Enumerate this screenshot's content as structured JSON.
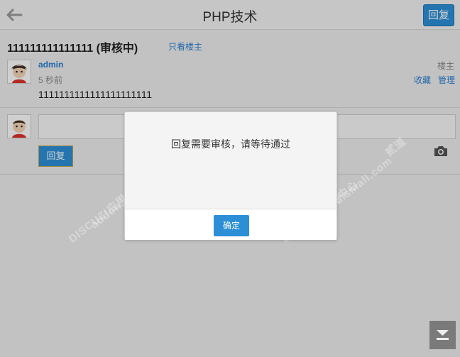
{
  "header": {
    "back_icon": "arrow-left-icon",
    "title": "PHP技术",
    "reply_label": "回复"
  },
  "thread": {
    "title": "111111111111111 (审核中)",
    "only_op_label": "只看楼主"
  },
  "post": {
    "author": "admin",
    "time": "5 秒前",
    "op_badge": "楼主",
    "favorite_label": "收藏",
    "manage_label": "管理",
    "content": "1111111111111111111111"
  },
  "reply_form": {
    "input_value": "",
    "submit_label": "回复",
    "camera_icon": "camera-icon"
  },
  "dialog": {
    "message": "回复需要审核，请等待通过",
    "ok_label": "确定"
  },
  "watermark": {
    "brand": "DISCUZ!应用中心",
    "domain": "addon.dismall.com",
    "suffix": "贰道"
  },
  "colors": {
    "accent": "#2c8fd6",
    "link": "#2a7fd0"
  },
  "scroll_bottom_icon": "arrow-down-to-bottom-icon"
}
